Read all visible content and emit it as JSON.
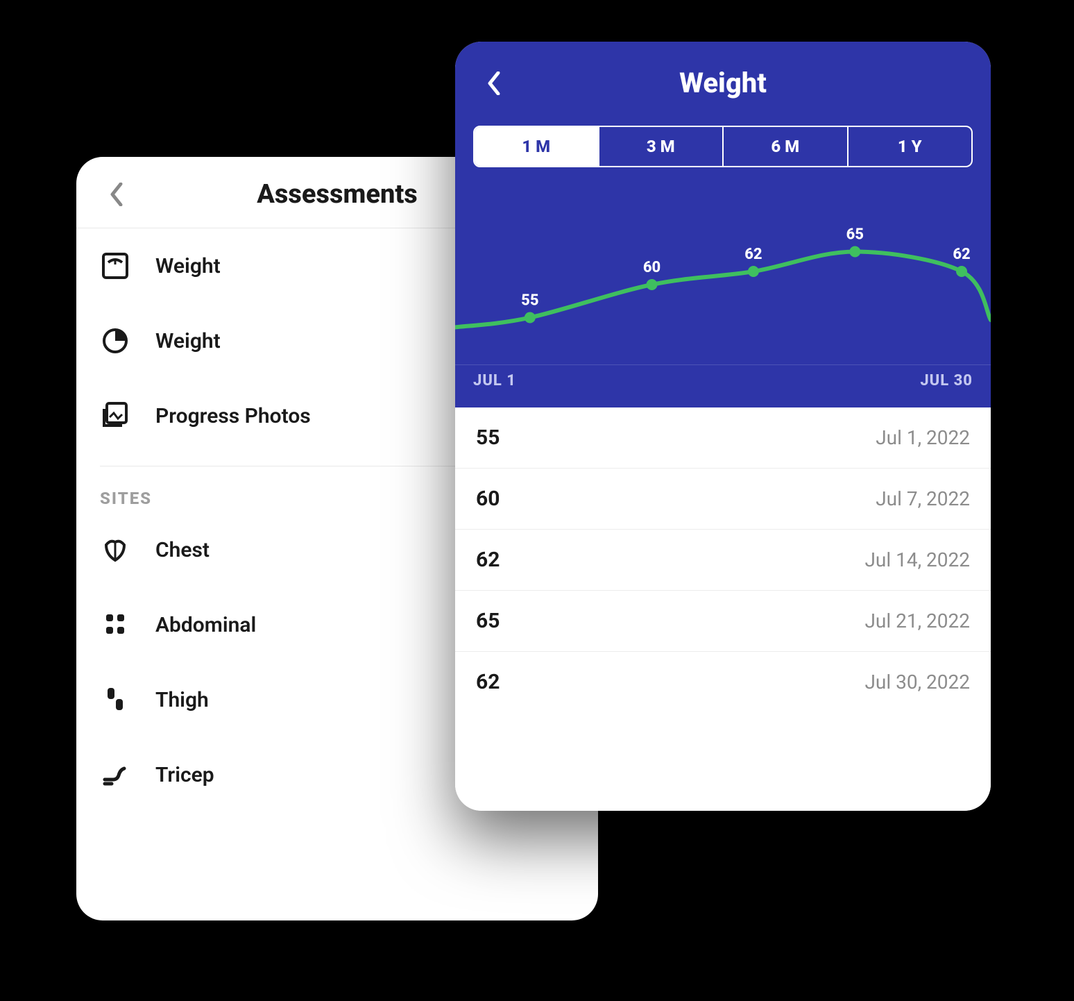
{
  "assessments": {
    "title": "Assessments",
    "items": [
      {
        "label": "Weight",
        "icon": "scale-icon"
      },
      {
        "label": "Weight",
        "icon": "piechart-icon"
      },
      {
        "label": "Progress Photos",
        "icon": "photos-icon"
      }
    ],
    "sites_header": "SITES",
    "sites": [
      {
        "label": "Chest",
        "icon": "chest-icon"
      },
      {
        "label": "Abdominal",
        "icon": "abdominal-icon"
      },
      {
        "label": "Thigh",
        "icon": "thigh-icon"
      },
      {
        "label": "Tricep",
        "icon": "tricep-icon"
      }
    ]
  },
  "weight_detail": {
    "title": "Weight",
    "ranges": [
      "1 M",
      "3 M",
      "6 M",
      "1 Y"
    ],
    "active_range_index": 0,
    "date_start": "JUL 1",
    "date_end": "JUL 30",
    "entries": [
      {
        "value": "55",
        "date": "Jul 1, 2022"
      },
      {
        "value": "60",
        "date": "Jul 7, 2022"
      },
      {
        "value": "62",
        "date": "Jul 14, 2022"
      },
      {
        "value": "65",
        "date": "Jul 21, 2022"
      },
      {
        "value": "62",
        "date": "Jul 30, 2022"
      }
    ]
  },
  "chart_data": {
    "type": "line",
    "title": "Weight",
    "xlabel": "",
    "ylabel": "",
    "x": [
      "Jul 1",
      "Jul 7",
      "Jul 14",
      "Jul 21",
      "Jul 30"
    ],
    "values": [
      55,
      60,
      62,
      65,
      62
    ],
    "ylim": [
      50,
      70
    ],
    "xrange_labels": [
      "JUL 1",
      "JUL 30"
    ],
    "color": "#3fbf5f"
  }
}
